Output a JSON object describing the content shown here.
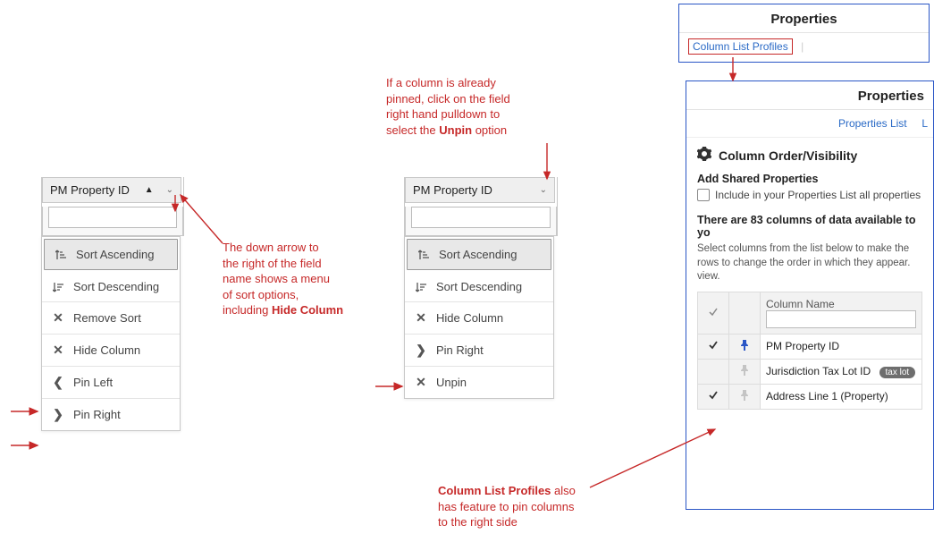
{
  "menu_left": {
    "header_label": "PM Property ID",
    "items": [
      {
        "label": "Sort Ascending"
      },
      {
        "label": "Sort Descending"
      },
      {
        "label": "Remove Sort"
      },
      {
        "label": "Hide Column"
      },
      {
        "label": "Pin Left"
      },
      {
        "label": "Pin Right"
      }
    ]
  },
  "menu_right": {
    "header_label": "PM Property ID",
    "items": [
      {
        "label": "Sort Ascending"
      },
      {
        "label": "Sort Descending"
      },
      {
        "label": "Hide Column"
      },
      {
        "label": "Pin Right"
      },
      {
        "label": "Unpin"
      }
    ]
  },
  "top_panel": {
    "title": "Properties",
    "link": "Column List Profiles"
  },
  "bottom_panel": {
    "title": "Properties",
    "tab1": "Properties List",
    "tab2": "L",
    "section_title": "Column Order/Visibility",
    "add_shared": "Add Shared Properties",
    "include_text": "Include in your Properties List all properties",
    "count_text": "There are 83 columns of data available to yo",
    "help1": "Select columns from the list below to make the",
    "help2": "rows to change the order in which they appear.",
    "help3": "view.",
    "col_header": "Column Name",
    "rows": [
      {
        "checked": true,
        "pinned": true,
        "label": "PM Property ID",
        "pill": ""
      },
      {
        "checked": false,
        "pinned": false,
        "label": "Jurisdiction Tax Lot ID",
        "pill": "tax lot"
      },
      {
        "checked": true,
        "pinned": false,
        "label": "Address Line 1 (Property)",
        "pill": ""
      }
    ]
  },
  "annotations": {
    "a1a": "The down arrow to",
    "a1b": "the right of the field",
    "a1c": "name shows a menu",
    "a1d": "of sort options,",
    "a1e": "including ",
    "a1e_b": "Hide Column",
    "a2a": "If a column is already",
    "a2b": "pinned, click on the field",
    "a2c": "right hand pulldown to",
    "a2d": "select the ",
    "a2d_b": "Unpin",
    "a2d2": " option",
    "a3a_b": "Column List Profiles",
    "a3a2": " also",
    "a3b": "has feature to pin columns",
    "a3c": "to the right side"
  }
}
